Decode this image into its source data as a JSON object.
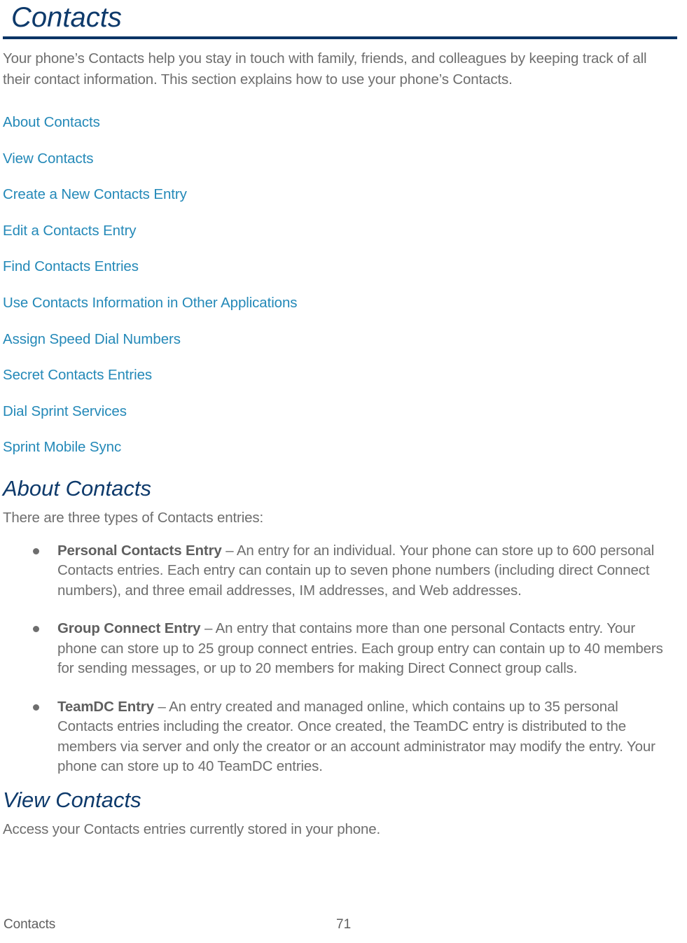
{
  "document": {
    "chapter_title": "Contacts",
    "intro_paragraph": "Your phone’s Contacts help you stay in touch with family, friends, and colleagues by keeping track of all their contact information. This section explains how to use your phone’s Contacts.",
    "accent_colors": {
      "heading_navy": "#0E3A6B",
      "rule_navy": "#0A3465",
      "link_blue": "#2489B8",
      "body_gray": "#6E6E6E"
    }
  },
  "toc": {
    "items": [
      {
        "label": "About Contacts"
      },
      {
        "label": "View Contacts"
      },
      {
        "label": "Create a New Contacts Entry"
      },
      {
        "label": "Edit a Contacts Entry"
      },
      {
        "label": "Find Contacts Entries"
      },
      {
        "label": "Use Contacts Information in Other Applications"
      },
      {
        "label": "Assign Speed Dial Numbers"
      },
      {
        "label": "Secret Contacts Entries"
      },
      {
        "label": "Dial Sprint Services"
      },
      {
        "label": "Sprint Mobile Sync"
      }
    ]
  },
  "sections": [
    {
      "heading": "About Contacts",
      "intro": "There are three types of Contacts entries:",
      "bullets": [
        {
          "term": "Personal Contacts Entry",
          "body": " – An entry for an individual. Your phone can store up to 600 personal Contacts entries. Each entry can contain up to seven phone numbers (including direct Connect numbers), and three email addresses, IM addresses, and Web addresses."
        },
        {
          "term": "Group Connect Entry",
          "body": " – An entry that contains more than one personal Contacts entry. Your phone can store up to 25 group connect entries. Each group entry can contain up to 40 members for sending messages, or up to 20 members for making Direct Connect group calls."
        },
        {
          "term": "TeamDC Entry",
          "body": " – An entry created and managed online, which contains up to 35 personal Contacts entries including the creator. Once created, the TeamDC entry is distributed to the members via server and only the creator or an account administrator may modify the entry. Your phone can store up to 40 TeamDC entries."
        }
      ]
    },
    {
      "heading": "View Contacts",
      "intro": "Access your Contacts entries currently stored in your phone.",
      "bullets": []
    }
  ],
  "footer": {
    "section_name": "Contacts",
    "page_number": "71"
  }
}
